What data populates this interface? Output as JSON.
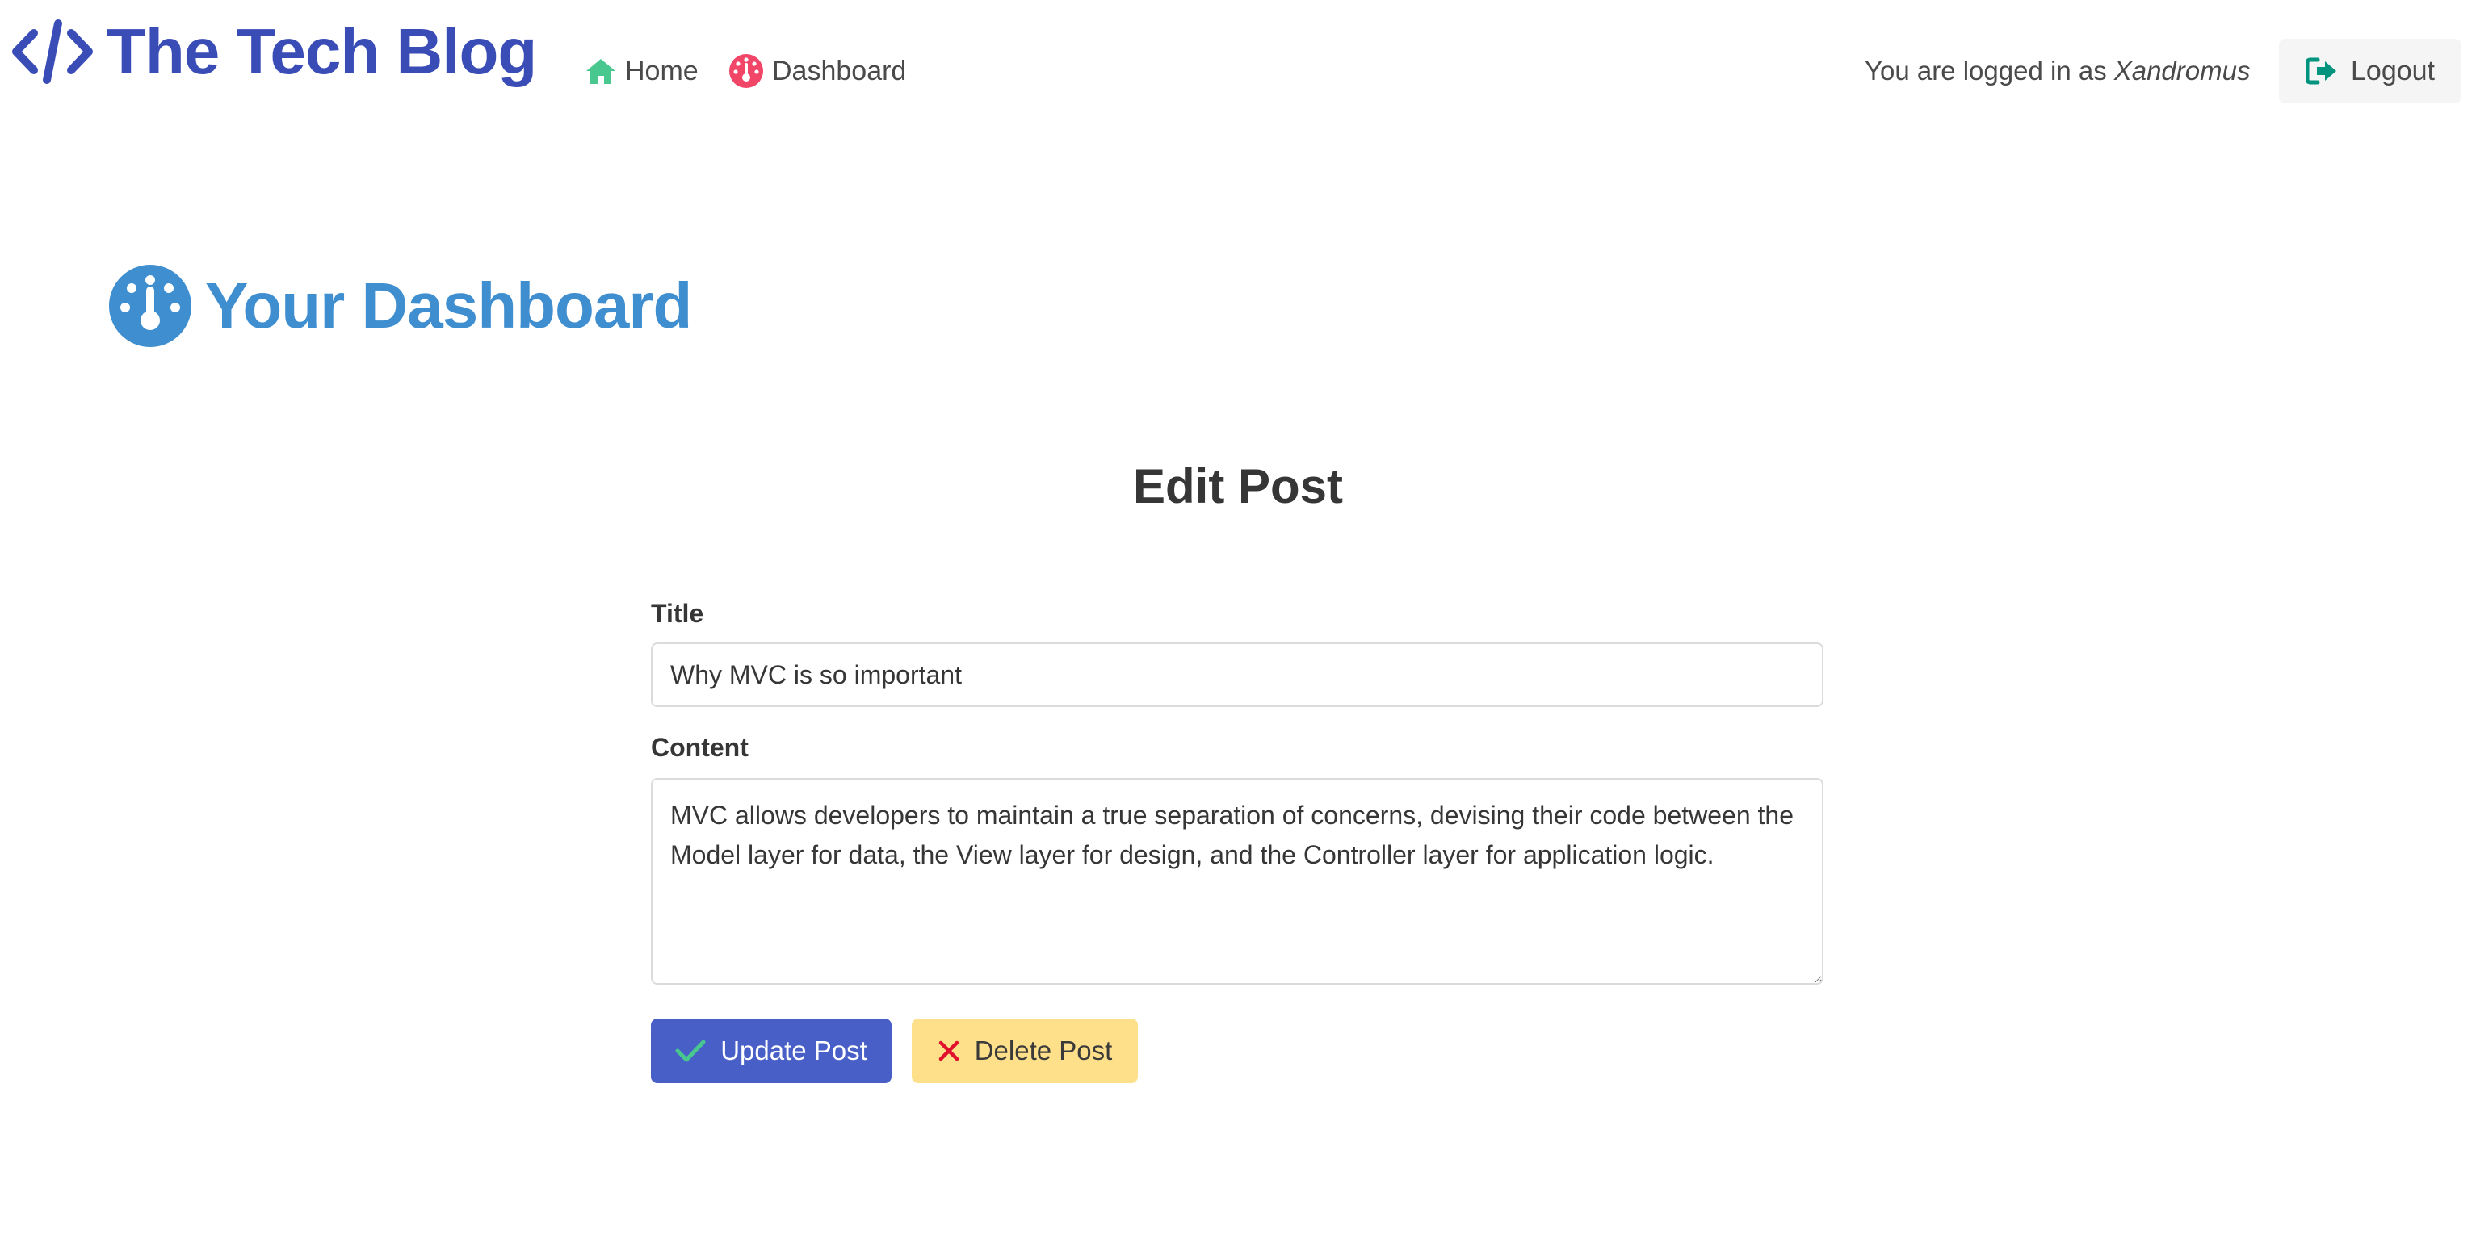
{
  "navbar": {
    "brand": {
      "text": "The Tech Blog",
      "icon": "code-icon",
      "color": "#3a4db7"
    },
    "links": [
      {
        "label": "Home",
        "icon": "home-icon",
        "icon_color": "#48c78e"
      },
      {
        "label": "Dashboard",
        "icon": "gauge-icon",
        "icon_color": "#f14668"
      }
    ],
    "login_status": {
      "prefix": "You are logged in as",
      "username": "Xandromus"
    },
    "logout": {
      "label": "Logout",
      "icon": "sign-out-icon",
      "icon_color": "#00947e"
    }
  },
  "dashboard": {
    "heading": "Your Dashboard",
    "icon": "gauge-icon",
    "color": "#3e8ed0"
  },
  "form": {
    "heading": "Edit Post",
    "title_label": "Title",
    "title_value": "Why MVC is so important",
    "content_label": "Content",
    "content_value": "MVC allows developers to maintain a true separation of concerns, devising their code between the Model layer for data, the View layer for design, and the Controller layer for application logic.",
    "update_button": {
      "label": "Update Post",
      "icon": "check-icon",
      "icon_color": "#48c78e",
      "bg": "#485fc7"
    },
    "delete_button": {
      "label": "Delete Post",
      "icon": "x-icon",
      "icon_color": "#e0102e",
      "bg": "#ffe08a"
    }
  }
}
